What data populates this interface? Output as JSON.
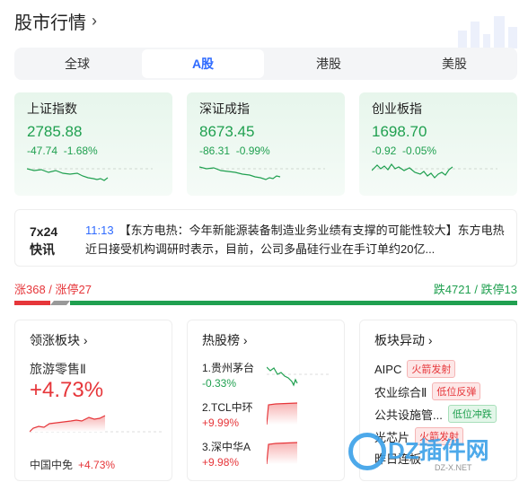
{
  "header": {
    "title": "股市行情",
    "chevron_icon": "chevron-right-icon"
  },
  "tabs": [
    {
      "label": "全球",
      "active": false
    },
    {
      "label": "A股",
      "active": true
    },
    {
      "label": "港股",
      "active": false
    },
    {
      "label": "美股",
      "active": false
    }
  ],
  "indices": [
    {
      "name": "上证指数",
      "value": "2785.88",
      "change": "-47.74",
      "pct": "-1.68%"
    },
    {
      "name": "深证成指",
      "value": "8673.45",
      "change": "-86.31",
      "pct": "-0.99%"
    },
    {
      "name": "创业板指",
      "value": "1698.70",
      "change": "-0.92",
      "pct": "-0.05%"
    }
  ],
  "news": {
    "badge_line1": "7x24",
    "badge_line2": "快讯",
    "time": "11:13",
    "text": "【东方电热：今年新能源装备制造业务业绩有支撑的可能性较大】东方电热近日接受机构调研时表示，目前，公司多晶硅行业在手订单约20亿..."
  },
  "breadth": {
    "up_text": "涨368 / 涨停27",
    "down_text": "跌4721 / 跌停13",
    "up_fraction": 0.072,
    "colors": {
      "up": "#e6363a",
      "down": "#20a050",
      "flat": "#999999"
    }
  },
  "leading_sector": {
    "title": "领涨板块",
    "sector": "旅游零售Ⅱ",
    "pct": "+4.73%",
    "leader_name": "中国中免",
    "leader_pct": "+4.73%"
  },
  "hot_stocks": {
    "title": "热股榜",
    "items": [
      {
        "name": "1.贵州茅台",
        "pct": "-0.33%",
        "direction": "down"
      },
      {
        "name": "2.TCL中环",
        "pct": "+9.99%",
        "direction": "up"
      },
      {
        "name": "3.深中华A",
        "pct": "+9.98%",
        "direction": "up"
      }
    ]
  },
  "sector_moves": {
    "title": "板块异动",
    "items": [
      {
        "name": "AIPC",
        "tag": "火箭发射",
        "tag_color": "red"
      },
      {
        "name": "农业综合Ⅱ",
        "tag": "低位反弹",
        "tag_color": "red"
      },
      {
        "name": "公共设施管...",
        "tag": "低位冲跌",
        "tag_color": "green"
      },
      {
        "name": "光芯片",
        "tag": "火箭发射",
        "tag_color": "red"
      },
      {
        "name": "昨日连板",
        "tag": "",
        "tag_color": "green"
      }
    ]
  },
  "watermark": {
    "text": "DZ插件网",
    "url": "DZ-X.NET"
  }
}
